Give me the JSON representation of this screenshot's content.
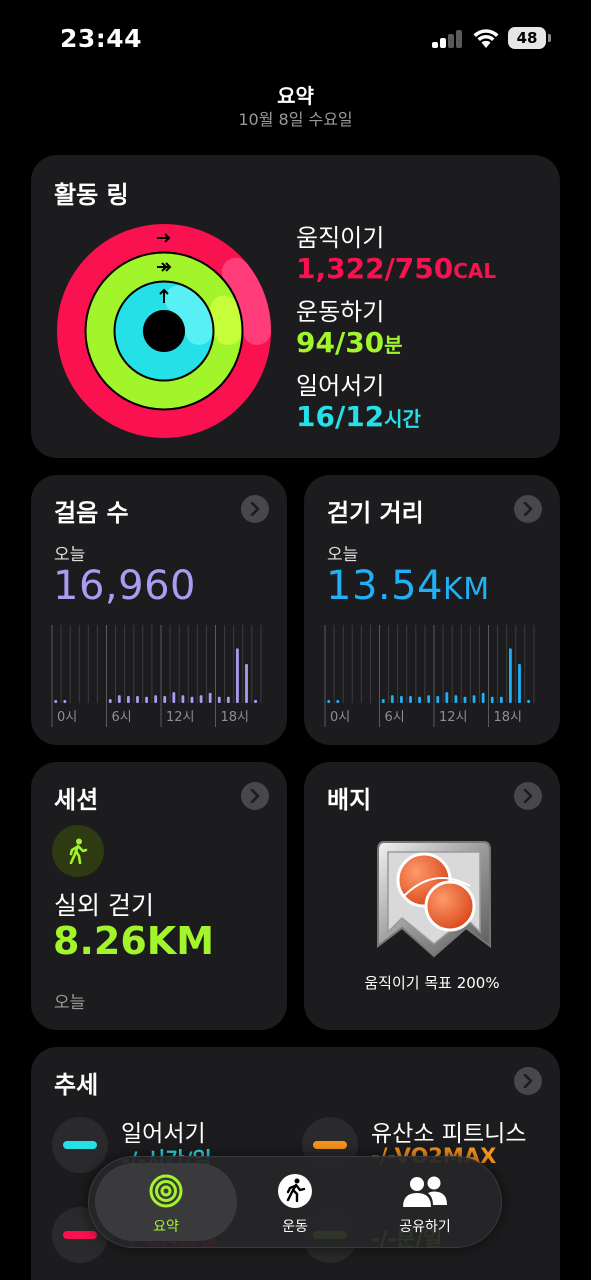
{
  "status_bar": {
    "time": "23:44",
    "battery": "48"
  },
  "header": {
    "title": "요약",
    "subtitle": "10월 8일 수요일"
  },
  "activity_rings": {
    "title": "활동 링",
    "move": {
      "label": "움직이기",
      "value": "1,322/750",
      "unit": "CAL",
      "color": "#fa114f",
      "progress": 1.76
    },
    "exercise": {
      "label": "운동하기",
      "value": "94/30",
      "unit": "분",
      "color": "#a3f52b",
      "progress": 3.13
    },
    "stand": {
      "label": "일어서기",
      "value": "16/12",
      "unit": "시간",
      "color": "#26e0e8",
      "progress": 1.33
    }
  },
  "steps": {
    "title": "걸음 수",
    "today_label": "오늘",
    "value": "16,960",
    "color": "#a99df0",
    "axis_labels": [
      "0시",
      "6시",
      "12시",
      "18시"
    ],
    "hourly": [
      0.02,
      0.02,
      0,
      0,
      0,
      0,
      0.05,
      0.1,
      0.09,
      0.09,
      0.08,
      0.1,
      0.09,
      0.14,
      0.1,
      0.08,
      0.1,
      0.13,
      0.08,
      0.08,
      0.7,
      0.5,
      0.04,
      0
    ]
  },
  "distance": {
    "title": "걷기 거리",
    "today_label": "오늘",
    "value": "13.54",
    "unit": "KM",
    "color": "#1fb0f5",
    "axis_labels": [
      "0시",
      "6시",
      "12시",
      "18시"
    ],
    "hourly": [
      0.02,
      0.02,
      0,
      0,
      0,
      0,
      0.05,
      0.1,
      0.09,
      0.09,
      0.08,
      0.1,
      0.09,
      0.14,
      0.1,
      0.08,
      0.1,
      0.13,
      0.08,
      0.08,
      0.7,
      0.5,
      0.04,
      0
    ]
  },
  "sessions": {
    "title": "세션",
    "activity": "실외 걷기",
    "value": "8.26KM",
    "date": "오늘",
    "icon": "walking-figure-icon"
  },
  "badges": {
    "title": "배지",
    "caption": "움직이기 목표 200%"
  },
  "trends": {
    "title": "추세",
    "items": [
      {
        "label": "일어서기",
        "value": "-/-시간/일",
        "color": "#26e0e8"
      },
      {
        "label": "유산소 피트니스",
        "value": "-/-VO2MAX",
        "color": "#f7941d"
      },
      {
        "label": "",
        "value": "-/-CAL/일",
        "color": "#fa114f"
      },
      {
        "label": "",
        "value": "-/-분/일",
        "color": "#a3f52b"
      }
    ]
  },
  "tab_bar": {
    "tabs": [
      {
        "label": "요약",
        "active": true
      },
      {
        "label": "운동",
        "active": false
      },
      {
        "label": "공유하기",
        "active": false
      }
    ]
  }
}
